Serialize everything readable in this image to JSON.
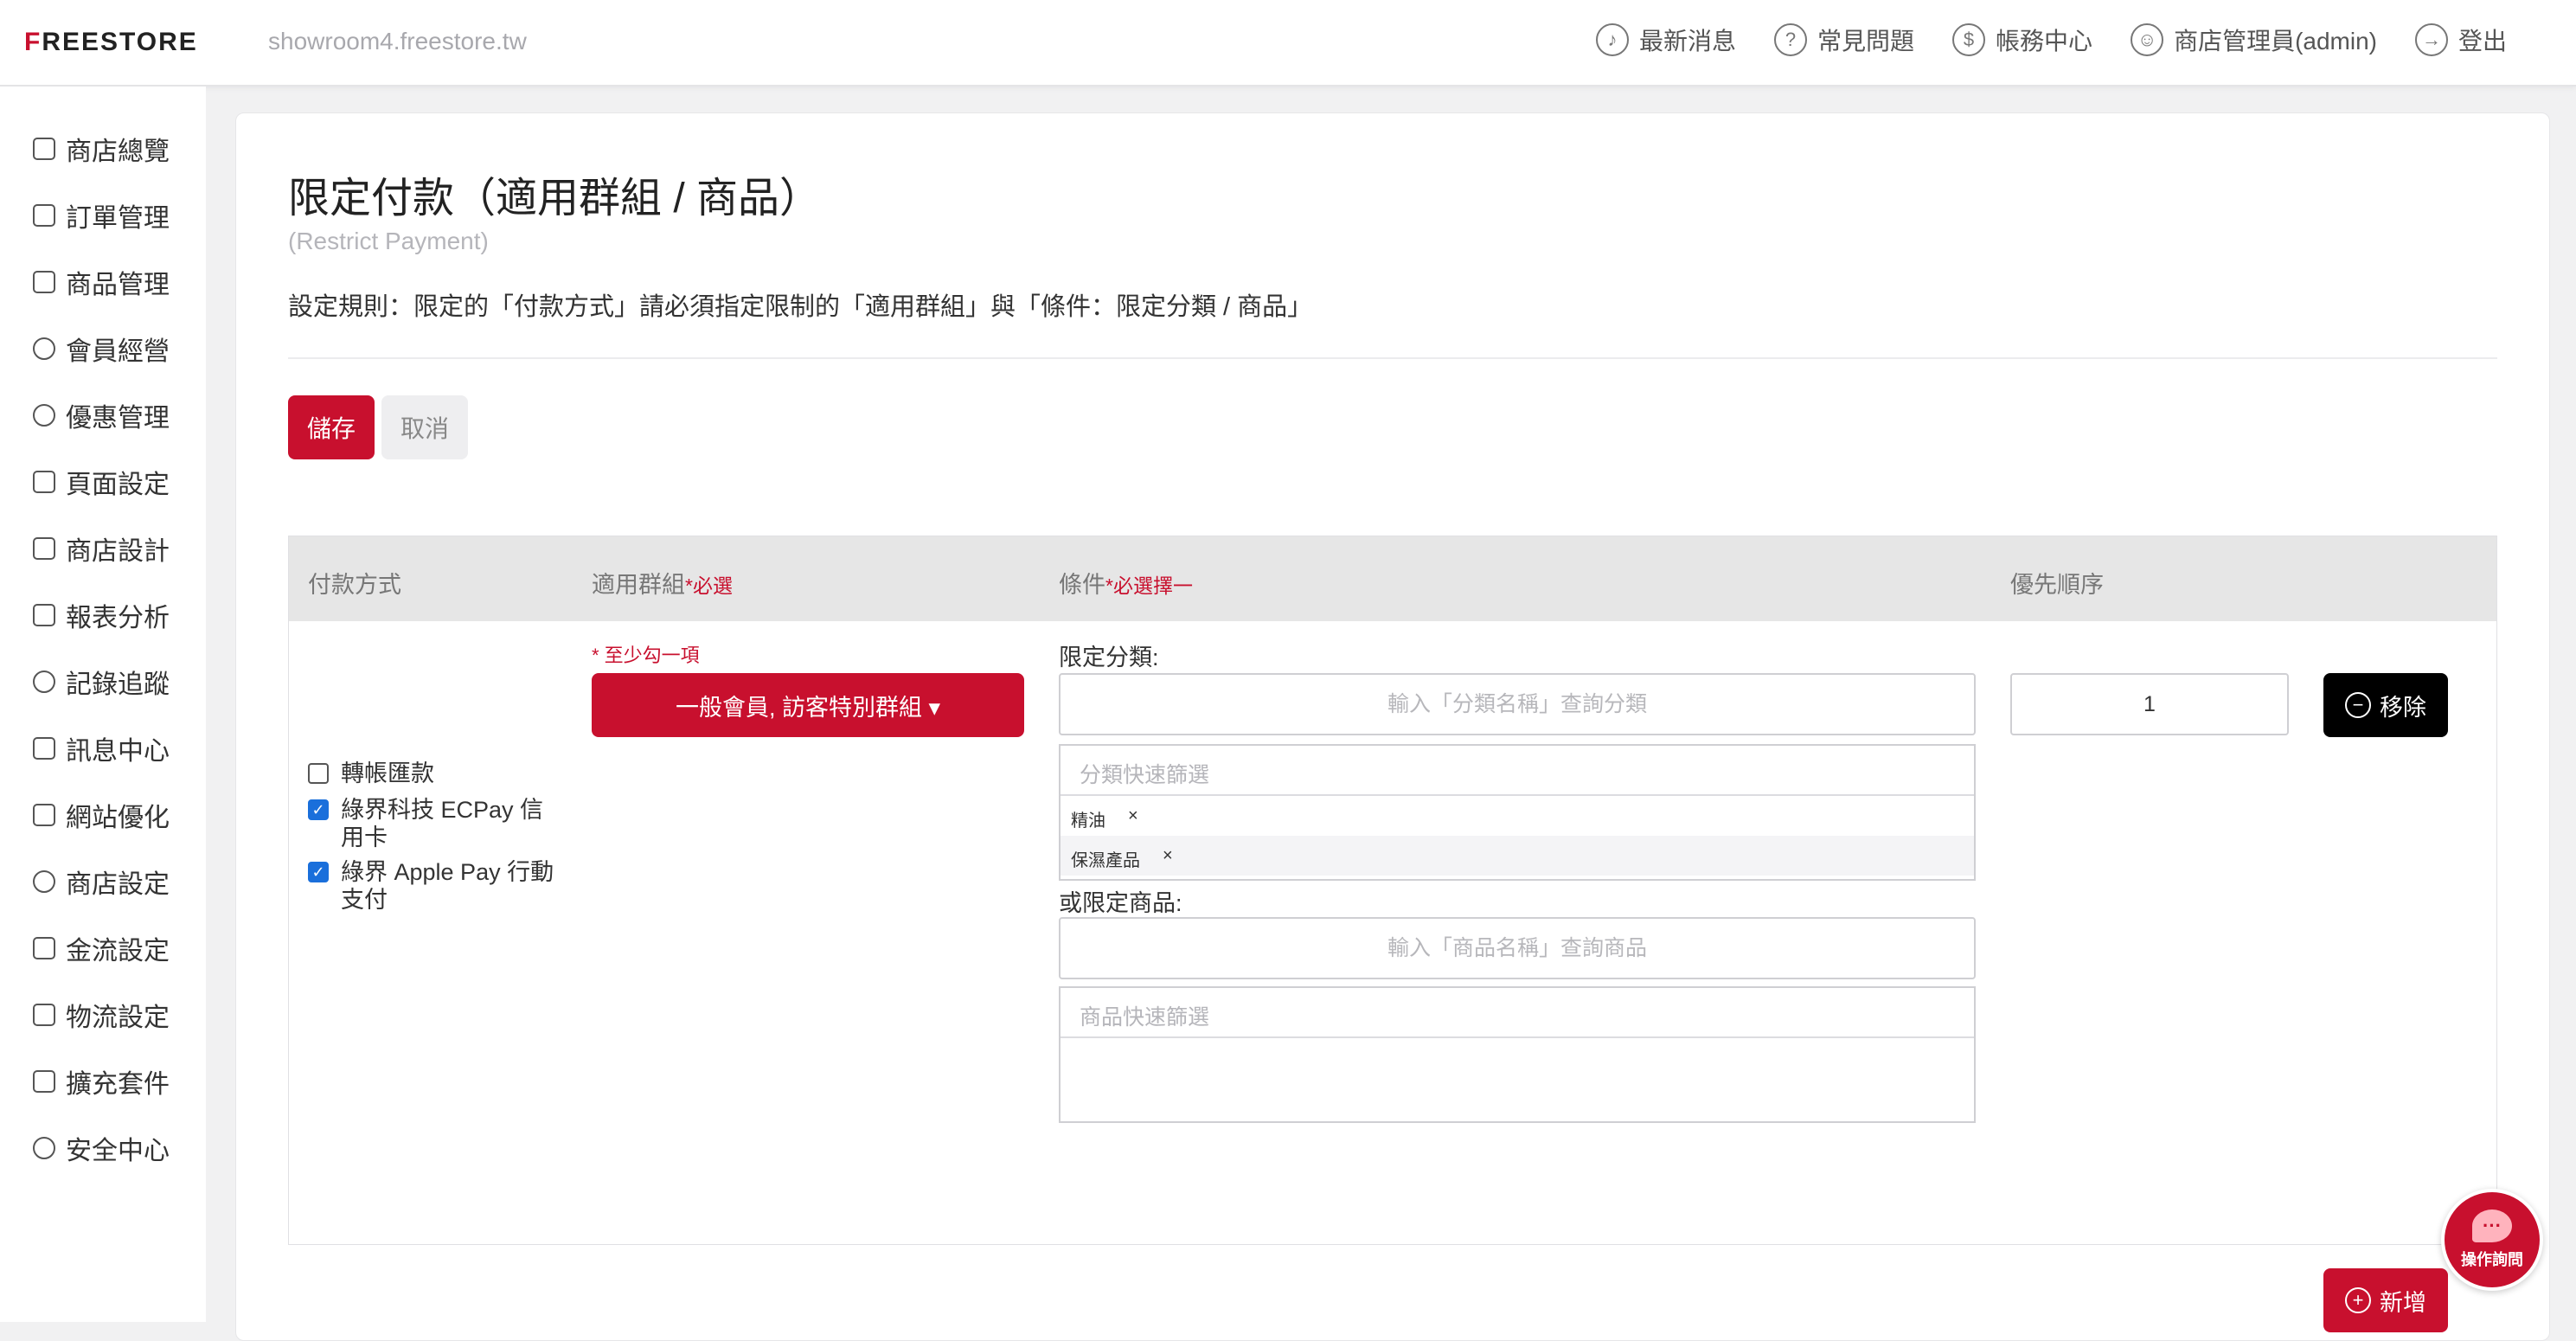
{
  "header": {
    "logo": "FREESTORE",
    "domain": "showroom4.freestore.tw",
    "nav": [
      {
        "label": "最新消息",
        "icon": "bell-icon"
      },
      {
        "label": "常見問題",
        "icon": "question-icon"
      },
      {
        "label": "帳務中心",
        "icon": "dollar-icon"
      },
      {
        "label": "商店管理員(admin)",
        "icon": "user-icon"
      },
      {
        "label": "登出",
        "icon": "logout-icon"
      }
    ]
  },
  "sidebar": {
    "items": [
      {
        "label": "商店總覽",
        "icon": "grid-icon"
      },
      {
        "label": "訂單管理",
        "icon": "basket-icon"
      },
      {
        "label": "商品管理",
        "icon": "clipboard-icon"
      },
      {
        "label": "會員經營",
        "icon": "person-icon"
      },
      {
        "label": "優惠管理",
        "icon": "badge-icon"
      },
      {
        "label": "頁面設定",
        "icon": "page-icon"
      },
      {
        "label": "商店設計",
        "icon": "paint-roller-icon"
      },
      {
        "label": "報表分析",
        "icon": "chart-icon"
      },
      {
        "label": "記錄追蹤",
        "icon": "target-icon"
      },
      {
        "label": "訊息中心",
        "icon": "megaphone-icon"
      },
      {
        "label": "網站優化",
        "icon": "monitor-icon"
      },
      {
        "label": "商店設定",
        "icon": "gear-icon"
      },
      {
        "label": "金流設定",
        "icon": "card-icon"
      },
      {
        "label": "物流設定",
        "icon": "truck-icon"
      },
      {
        "label": "擴充套件",
        "icon": "apps-icon"
      },
      {
        "label": "安全中心",
        "icon": "shield-icon"
      }
    ]
  },
  "page": {
    "title": "限定付款（適用群組 / 商品）",
    "subtitle": "(Restrict Payment)",
    "rule": "設定規則：限定的「付款方式」請必須指定限制的「適用群組」與「條件：限定分類 / 商品」",
    "save_label": "儲存",
    "cancel_label": "取消"
  },
  "table": {
    "headers": {
      "payment": "付款方式",
      "group": "適用群組",
      "group_req": "*必選",
      "condition": "條件",
      "condition_req": "*必選擇一",
      "priority": "優先順序"
    },
    "row": {
      "payments": [
        {
          "label": "轉帳匯款",
          "checked": false
        },
        {
          "label": "綠界科技 ECPay 信用卡",
          "checked": true
        },
        {
          "label": "綠界 Apple Pay 行動支付",
          "checked": true
        }
      ],
      "group_hint": "* 至少勾一項",
      "group_value": "一般會員, 訪客特別群組",
      "category_label": "限定分類:",
      "category_placeholder": "輸入「分類名稱」查詢分類",
      "category_filter": "分類快速篩選",
      "category_tags": [
        "精油",
        "保濕產品"
      ],
      "product_label": "或限定商品:",
      "product_placeholder": "輸入「商品名稱」查詢商品",
      "product_filter": "商品快速篩選",
      "priority_value": "1",
      "remove_label": "移除"
    },
    "add_label": "新增"
  },
  "help": {
    "label": "操作詢問"
  }
}
